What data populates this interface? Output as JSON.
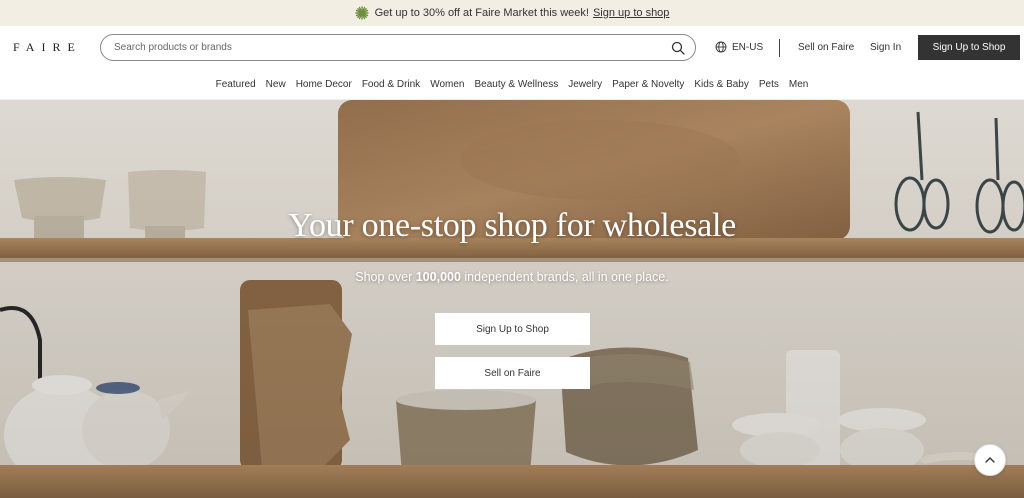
{
  "promo": {
    "text": "Get up to 30% off at Faire Market this week!",
    "link": "Sign up to shop",
    "icon": "sunburst-icon",
    "background": "#f3eee4"
  },
  "header": {
    "logo": "FAIRE",
    "search_placeholder": "Search products or brands",
    "language": "EN-US",
    "sell_label": "Sell on Faire",
    "signin_label": "Sign In",
    "signup_label": "Sign Up to Shop",
    "signup_color": "#333333"
  },
  "nav": {
    "items": [
      "Featured",
      "New",
      "Home Decor",
      "Food & Drink",
      "Women",
      "Beauty & Wellness",
      "Jewelry",
      "Paper & Novelty",
      "Kids & Baby",
      "Pets",
      "Men"
    ]
  },
  "hero": {
    "title": "Your one-stop shop for wholesale",
    "subtitle_pre": "Shop over ",
    "subtitle_bold": "100,000",
    "subtitle_post": " independent brands, all in one place.",
    "button_primary": "Sign Up to Shop",
    "button_secondary": "Sell on Faire"
  }
}
